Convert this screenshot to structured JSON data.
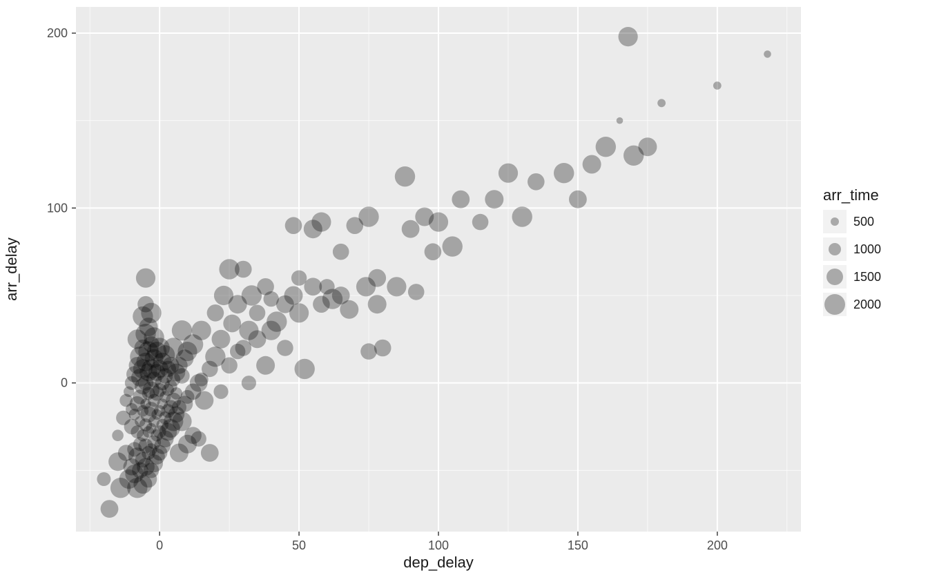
{
  "chart_data": {
    "type": "scatter",
    "xlabel": "dep_delay",
    "ylabel": "arr_delay",
    "title": "",
    "xlim": [
      -30,
      230
    ],
    "ylim": [
      -85,
      215
    ],
    "x_ticks": [
      0,
      50,
      100,
      150,
      200
    ],
    "y_ticks": [
      0,
      100,
      200
    ],
    "size_var": "arr_time",
    "size_legend": [
      500,
      1000,
      1500,
      2000
    ],
    "points": [
      {
        "x": -20,
        "y": -55,
        "s": 1200
      },
      {
        "x": -18,
        "y": -72,
        "s": 1700
      },
      {
        "x": -15,
        "y": -45,
        "s": 1800
      },
      {
        "x": -15,
        "y": -30,
        "s": 900
      },
      {
        "x": -14,
        "y": -60,
        "s": 2000
      },
      {
        "x": -13,
        "y": -20,
        "s": 1300
      },
      {
        "x": -12,
        "y": -40,
        "s": 1500
      },
      {
        "x": -12,
        "y": -10,
        "s": 1100
      },
      {
        "x": -11,
        "y": -55,
        "s": 1900
      },
      {
        "x": -11,
        "y": -5,
        "s": 800
      },
      {
        "x": -10,
        "y": -48,
        "s": 1600
      },
      {
        "x": -10,
        "y": -25,
        "s": 1400
      },
      {
        "x": -10,
        "y": -15,
        "s": 1000
      },
      {
        "x": -10,
        "y": 0,
        "s": 1200
      },
      {
        "x": -9,
        "y": -52,
        "s": 1800
      },
      {
        "x": -9,
        "y": -38,
        "s": 1300
      },
      {
        "x": -9,
        "y": -18,
        "s": 900
      },
      {
        "x": -9,
        "y": 5,
        "s": 1500
      },
      {
        "x": -8,
        "y": -60,
        "s": 2000
      },
      {
        "x": -8,
        "y": -42,
        "s": 1700
      },
      {
        "x": -8,
        "y": -28,
        "s": 1100
      },
      {
        "x": -8,
        "y": -12,
        "s": 1400
      },
      {
        "x": -8,
        "y": 10,
        "s": 1600
      },
      {
        "x": -8,
        "y": 25,
        "s": 1900
      },
      {
        "x": -7,
        "y": -50,
        "s": 1500
      },
      {
        "x": -7,
        "y": -35,
        "s": 1200
      },
      {
        "x": -7,
        "y": -22,
        "s": 800
      },
      {
        "x": -7,
        "y": -8,
        "s": 1300
      },
      {
        "x": -7,
        "y": 3,
        "s": 1700
      },
      {
        "x": -7,
        "y": 15,
        "s": 2000
      },
      {
        "x": -6,
        "y": -58,
        "s": 1800
      },
      {
        "x": -6,
        "y": -44,
        "s": 1400
      },
      {
        "x": -6,
        "y": -30,
        "s": 1000
      },
      {
        "x": -6,
        "y": -16,
        "s": 900
      },
      {
        "x": -6,
        "y": -2,
        "s": 1500
      },
      {
        "x": -6,
        "y": 8,
        "s": 1900
      },
      {
        "x": -6,
        "y": 20,
        "s": 1600
      },
      {
        "x": -6,
        "y": 38,
        "s": 2000
      },
      {
        "x": -5,
        "y": -48,
        "s": 1700
      },
      {
        "x": -5,
        "y": -36,
        "s": 1300
      },
      {
        "x": -5,
        "y": -24,
        "s": 1100
      },
      {
        "x": -5,
        "y": -12,
        "s": 800
      },
      {
        "x": -5,
        "y": 0,
        "s": 1400
      },
      {
        "x": -5,
        "y": 12,
        "s": 1800
      },
      {
        "x": -5,
        "y": 28,
        "s": 2000
      },
      {
        "x": -5,
        "y": 45,
        "s": 1500
      },
      {
        "x": -5,
        "y": 60,
        "s": 1900
      },
      {
        "x": -4,
        "y": -55,
        "s": 1600
      },
      {
        "x": -4,
        "y": -40,
        "s": 1200
      },
      {
        "x": -4,
        "y": -28,
        "s": 900
      },
      {
        "x": -4,
        "y": -18,
        "s": 1500
      },
      {
        "x": -4,
        "y": -6,
        "s": 1100
      },
      {
        "x": -4,
        "y": 6,
        "s": 1700
      },
      {
        "x": -4,
        "y": 18,
        "s": 2000
      },
      {
        "x": -4,
        "y": 32,
        "s": 1800
      },
      {
        "x": -3,
        "y": -50,
        "s": 1400
      },
      {
        "x": -3,
        "y": -38,
        "s": 1000
      },
      {
        "x": -3,
        "y": -26,
        "s": 800
      },
      {
        "x": -3,
        "y": -15,
        "s": 1300
      },
      {
        "x": -3,
        "y": -4,
        "s": 1600
      },
      {
        "x": -3,
        "y": 8,
        "s": 1900
      },
      {
        "x": -3,
        "y": 22,
        "s": 1500
      },
      {
        "x": -3,
        "y": 40,
        "s": 2000
      },
      {
        "x": -2,
        "y": -46,
        "s": 1700
      },
      {
        "x": -2,
        "y": -34,
        "s": 1200
      },
      {
        "x": -2,
        "y": -22,
        "s": 900
      },
      {
        "x": -2,
        "y": -10,
        "s": 1100
      },
      {
        "x": -2,
        "y": 2,
        "s": 1400
      },
      {
        "x": -2,
        "y": 14,
        "s": 1800
      },
      {
        "x": -2,
        "y": 26,
        "s": 2000
      },
      {
        "x": -1,
        "y": -42,
        "s": 1500
      },
      {
        "x": -1,
        "y": -30,
        "s": 1000
      },
      {
        "x": -1,
        "y": -18,
        "s": 800
      },
      {
        "x": -1,
        "y": -6,
        "s": 1300
      },
      {
        "x": -1,
        "y": 6,
        "s": 1600
      },
      {
        "x": -1,
        "y": 18,
        "s": 1900
      },
      {
        "x": 0,
        "y": -40,
        "s": 1400
      },
      {
        "x": 0,
        "y": -28,
        "s": 1100
      },
      {
        "x": 0,
        "y": -16,
        "s": 900
      },
      {
        "x": 0,
        "y": -4,
        "s": 1200
      },
      {
        "x": 0,
        "y": 8,
        "s": 1700
      },
      {
        "x": 0,
        "y": 20,
        "s": 2000
      },
      {
        "x": 1,
        "y": -36,
        "s": 1500
      },
      {
        "x": 1,
        "y": -24,
        "s": 1000
      },
      {
        "x": 1,
        "y": -12,
        "s": 800
      },
      {
        "x": 1,
        "y": 0,
        "s": 1300
      },
      {
        "x": 1,
        "y": 12,
        "s": 1800
      },
      {
        "x": 2,
        "y": -32,
        "s": 1600
      },
      {
        "x": 2,
        "y": -20,
        "s": 1100
      },
      {
        "x": 2,
        "y": -8,
        "s": 900
      },
      {
        "x": 2,
        "y": 4,
        "s": 1400
      },
      {
        "x": 2,
        "y": 16,
        "s": 1900
      },
      {
        "x": 3,
        "y": -28,
        "s": 1700
      },
      {
        "x": 3,
        "y": -16,
        "s": 1200
      },
      {
        "x": 3,
        "y": -4,
        "s": 1000
      },
      {
        "x": 3,
        "y": 8,
        "s": 1500
      },
      {
        "x": 4,
        "y": -26,
        "s": 1800
      },
      {
        "x": 4,
        "y": -14,
        "s": 1300
      },
      {
        "x": 4,
        "y": -2,
        "s": 1100
      },
      {
        "x": 4,
        "y": 10,
        "s": 1600
      },
      {
        "x": 5,
        "y": -22,
        "s": 1900
      },
      {
        "x": 5,
        "y": -10,
        "s": 1400
      },
      {
        "x": 5,
        "y": 2,
        "s": 1200
      },
      {
        "x": 5,
        "y": 20,
        "s": 2000
      },
      {
        "x": 6,
        "y": -18,
        "s": 1500
      },
      {
        "x": 6,
        "y": -6,
        "s": 1000
      },
      {
        "x": 6,
        "y": 6,
        "s": 1700
      },
      {
        "x": 7,
        "y": -40,
        "s": 1800
      },
      {
        "x": 7,
        "y": -14,
        "s": 1300
      },
      {
        "x": 7,
        "y": 10,
        "s": 1600
      },
      {
        "x": 8,
        "y": -22,
        "s": 1900
      },
      {
        "x": 8,
        "y": 4,
        "s": 1400
      },
      {
        "x": 8,
        "y": 30,
        "s": 2000
      },
      {
        "x": 9,
        "y": -12,
        "s": 1500
      },
      {
        "x": 9,
        "y": 14,
        "s": 1700
      },
      {
        "x": 10,
        "y": -35,
        "s": 1800
      },
      {
        "x": 10,
        "y": -8,
        "s": 1200
      },
      {
        "x": 10,
        "y": 18,
        "s": 1900
      },
      {
        "x": 12,
        "y": -5,
        "s": 1500
      },
      {
        "x": 12,
        "y": 22,
        "s": 2000
      },
      {
        "x": 12,
        "y": -30,
        "s": 1600
      },
      {
        "x": 14,
        "y": 0,
        "s": 1700
      },
      {
        "x": 14,
        "y": -32,
        "s": 1400
      },
      {
        "x": 15,
        "y": 30,
        "s": 1900
      },
      {
        "x": 15,
        "y": 2,
        "s": 1200
      },
      {
        "x": 16,
        "y": -10,
        "s": 1800
      },
      {
        "x": 18,
        "y": 8,
        "s": 1500
      },
      {
        "x": 18,
        "y": -40,
        "s": 1700
      },
      {
        "x": 20,
        "y": 15,
        "s": 2000
      },
      {
        "x": 20,
        "y": 40,
        "s": 1600
      },
      {
        "x": 22,
        "y": 25,
        "s": 1800
      },
      {
        "x": 22,
        "y": -5,
        "s": 1300
      },
      {
        "x": 23,
        "y": 50,
        "s": 1900
      },
      {
        "x": 25,
        "y": 10,
        "s": 1500
      },
      {
        "x": 25,
        "y": 65,
        "s": 2000
      },
      {
        "x": 26,
        "y": 34,
        "s": 1700
      },
      {
        "x": 28,
        "y": 18,
        "s": 1400
      },
      {
        "x": 28,
        "y": 45,
        "s": 1800
      },
      {
        "x": 30,
        "y": 65,
        "s": 1600
      },
      {
        "x": 30,
        "y": 20,
        "s": 1500
      },
      {
        "x": 32,
        "y": 30,
        "s": 1900
      },
      {
        "x": 32,
        "y": 0,
        "s": 1300
      },
      {
        "x": 33,
        "y": 50,
        "s": 2000
      },
      {
        "x": 35,
        "y": 25,
        "s": 1700
      },
      {
        "x": 35,
        "y": 40,
        "s": 1500
      },
      {
        "x": 38,
        "y": 10,
        "s": 1800
      },
      {
        "x": 38,
        "y": 55,
        "s": 1600
      },
      {
        "x": 40,
        "y": 30,
        "s": 1900
      },
      {
        "x": 40,
        "y": 48,
        "s": 1400
      },
      {
        "x": 42,
        "y": 35,
        "s": 2000
      },
      {
        "x": 45,
        "y": 45,
        "s": 1700
      },
      {
        "x": 45,
        "y": 20,
        "s": 1500
      },
      {
        "x": 48,
        "y": 50,
        "s": 1800
      },
      {
        "x": 48,
        "y": 90,
        "s": 1600
      },
      {
        "x": 50,
        "y": 40,
        "s": 1900
      },
      {
        "x": 50,
        "y": 60,
        "s": 1400
      },
      {
        "x": 52,
        "y": 8,
        "s": 2000
      },
      {
        "x": 55,
        "y": 55,
        "s": 1700
      },
      {
        "x": 55,
        "y": 88,
        "s": 1800
      },
      {
        "x": 58,
        "y": 45,
        "s": 1600
      },
      {
        "x": 58,
        "y": 92,
        "s": 1900
      },
      {
        "x": 60,
        "y": 55,
        "s": 1400
      },
      {
        "x": 62,
        "y": 48,
        "s": 2000
      },
      {
        "x": 65,
        "y": 50,
        "s": 1700
      },
      {
        "x": 65,
        "y": 75,
        "s": 1500
      },
      {
        "x": 68,
        "y": 42,
        "s": 1800
      },
      {
        "x": 70,
        "y": 90,
        "s": 1600
      },
      {
        "x": 74,
        "y": 55,
        "s": 1900
      },
      {
        "x": 75,
        "y": 95,
        "s": 2000
      },
      {
        "x": 75,
        "y": 18,
        "s": 1500
      },
      {
        "x": 78,
        "y": 60,
        "s": 1700
      },
      {
        "x": 78,
        "y": 45,
        "s": 1800
      },
      {
        "x": 80,
        "y": 20,
        "s": 1600
      },
      {
        "x": 85,
        "y": 55,
        "s": 1900
      },
      {
        "x": 88,
        "y": 118,
        "s": 2000
      },
      {
        "x": 90,
        "y": 88,
        "s": 1700
      },
      {
        "x": 92,
        "y": 52,
        "s": 1500
      },
      {
        "x": 95,
        "y": 95,
        "s": 1800
      },
      {
        "x": 98,
        "y": 75,
        "s": 1600
      },
      {
        "x": 100,
        "y": 92,
        "s": 1900
      },
      {
        "x": 105,
        "y": 78,
        "s": 2000
      },
      {
        "x": 108,
        "y": 105,
        "s": 1700
      },
      {
        "x": 115,
        "y": 92,
        "s": 1500
      },
      {
        "x": 120,
        "y": 105,
        "s": 1800
      },
      {
        "x": 125,
        "y": 120,
        "s": 1900
      },
      {
        "x": 130,
        "y": 95,
        "s": 2000
      },
      {
        "x": 135,
        "y": 115,
        "s": 1600
      },
      {
        "x": 145,
        "y": 120,
        "s": 2000
      },
      {
        "x": 150,
        "y": 105,
        "s": 1700
      },
      {
        "x": 155,
        "y": 125,
        "s": 1800
      },
      {
        "x": 160,
        "y": 135,
        "s": 2000
      },
      {
        "x": 165,
        "y": 150,
        "s": 300
      },
      {
        "x": 168,
        "y": 198,
        "s": 1900
      },
      {
        "x": 170,
        "y": 130,
        "s": 2000
      },
      {
        "x": 175,
        "y": 135,
        "s": 1800
      },
      {
        "x": 180,
        "y": 160,
        "s": 500
      },
      {
        "x": 200,
        "y": 170,
        "s": 500
      },
      {
        "x": 218,
        "y": 188,
        "s": 400
      }
    ]
  },
  "labels": {
    "xlabel": "dep_delay",
    "ylabel": "arr_delay",
    "legend_title": "arr_time",
    "legend_500": "500",
    "legend_1000": "1000",
    "legend_1500": "1500",
    "legend_2000": "2000",
    "xt_0": "0",
    "xt_50": "50",
    "xt_100": "100",
    "xt_150": "150",
    "xt_200": "200",
    "yt_0": "0",
    "yt_100": "100",
    "yt_200": "200"
  }
}
